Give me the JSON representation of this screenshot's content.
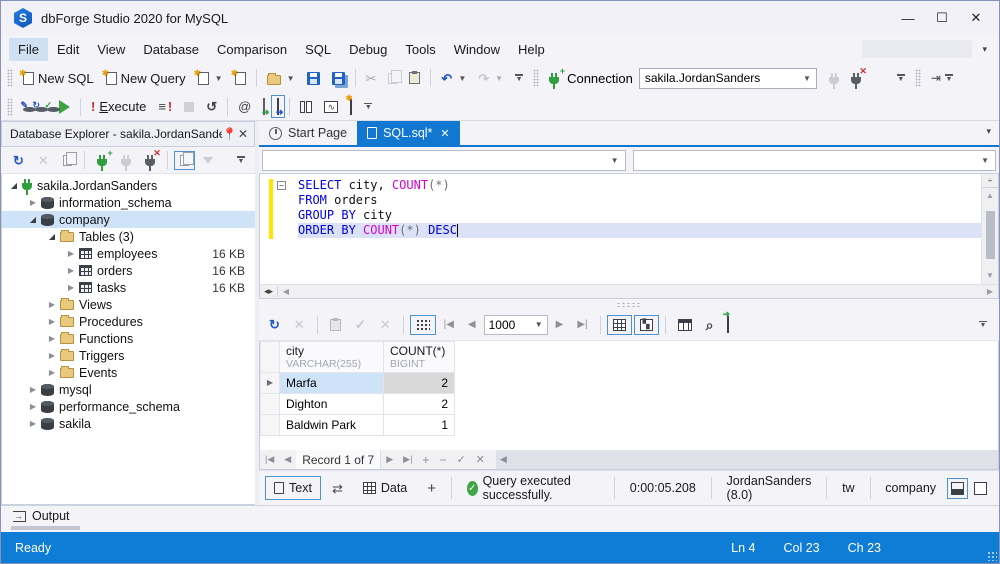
{
  "window": {
    "title": "dbForge Studio 2020 for MySQL",
    "minimize": "—",
    "maximize": "☐",
    "close": "✕"
  },
  "menu": {
    "items": [
      "File",
      "Edit",
      "View",
      "Database",
      "Comparison",
      "SQL",
      "Debug",
      "Tools",
      "Window",
      "Help"
    ]
  },
  "toolbar": {
    "new_sql": "New SQL",
    "new_query": "New Query",
    "execute": "Execute",
    "connection_label": "Connection",
    "connection_value": "sakila.JordanSanders"
  },
  "icons": {
    "cut": "✂",
    "undo": "↶",
    "redo": "↷",
    "refresh": "↻",
    "history": "↺",
    "close": "✕",
    "check": "✓",
    "exclaim": "!",
    "at": "@",
    "swap": "⇄",
    "plus": "+",
    "minus": "−",
    "search": "⌕",
    "cards": "▚",
    "prev": "◀",
    "next": "▶",
    "first": "|◀",
    "last": "▶|",
    "collapse": "−",
    "chart_line": "∿",
    "vsplit": "÷",
    "hsplit": "◂▸",
    "arrow_right": "→",
    "dropdown": "▼",
    "expander_closed": "▶",
    "expander_open": "◢",
    "row_arrow": "▶"
  },
  "explorer": {
    "title": "Database Explorer - sakila.JordanSanders",
    "tree": [
      {
        "label": "sakila.JordanSanders",
        "icon": "plug",
        "exp": "open",
        "level": 0
      },
      {
        "label": "information_schema",
        "icon": "db",
        "exp": "closed",
        "level": 1
      },
      {
        "label": "company",
        "icon": "db",
        "exp": "open",
        "level": 1,
        "selected": true
      },
      {
        "label": "Tables (3)",
        "icon": "folder",
        "exp": "open",
        "level": 2
      },
      {
        "label": "employees",
        "size": "16 KB",
        "icon": "table",
        "exp": "closed",
        "level": 3
      },
      {
        "label": "orders",
        "size": "16 KB",
        "icon": "table",
        "exp": "closed",
        "level": 3
      },
      {
        "label": "tasks",
        "size": "16 KB",
        "icon": "table",
        "exp": "closed",
        "level": 3
      },
      {
        "label": "Views",
        "icon": "folder",
        "exp": "closed",
        "level": 2
      },
      {
        "label": "Procedures",
        "icon": "folder",
        "exp": "closed",
        "level": 2
      },
      {
        "label": "Functions",
        "icon": "folder",
        "exp": "closed",
        "level": 2
      },
      {
        "label": "Triggers",
        "icon": "folder",
        "exp": "closed",
        "level": 2
      },
      {
        "label": "Events",
        "icon": "folder",
        "exp": "closed",
        "level": 2
      },
      {
        "label": "mysql",
        "icon": "db",
        "exp": "closed",
        "level": 1
      },
      {
        "label": "performance_schema",
        "icon": "db",
        "exp": "closed",
        "level": 1
      },
      {
        "label": "sakila",
        "icon": "db",
        "exp": "closed",
        "level": 1
      }
    ]
  },
  "tabs": [
    {
      "label": "Start Page",
      "active": false
    },
    {
      "label": "SQL.sql*",
      "active": true
    }
  ],
  "editor": {
    "lines": [
      {
        "tokens": [
          {
            "t": "SELECT",
            "c": "kw"
          },
          {
            "t": " city",
            "c": "id"
          },
          {
            "t": ", ",
            "c": "id"
          },
          {
            "t": "COUNT",
            "c": "fn"
          },
          {
            "t": "(*)",
            "c": "pn"
          }
        ]
      },
      {
        "tokens": [
          {
            "t": "FROM",
            "c": "kw"
          },
          {
            "t": " orders",
            "c": "id"
          }
        ]
      },
      {
        "tokens": [
          {
            "t": "GROUP BY",
            "c": "kw"
          },
          {
            "t": " city",
            "c": "id"
          }
        ]
      },
      {
        "tokens": [
          {
            "t": "ORDER BY",
            "c": "kw"
          },
          {
            "t": " ",
            "c": "id"
          },
          {
            "t": "COUNT",
            "c": "fn"
          },
          {
            "t": "(*)",
            "c": "pn"
          },
          {
            "t": " ",
            "c": "id"
          },
          {
            "t": "DESC",
            "c": "kw"
          }
        ],
        "highlighted": true,
        "caret": true
      }
    ]
  },
  "data_toolbar": {
    "page_size": "1000"
  },
  "grid": {
    "columns": [
      {
        "name": "city",
        "type": "VARCHAR(255)"
      },
      {
        "name": "COUNT(*)",
        "type": "BIGINT"
      }
    ],
    "rows": [
      {
        "city": "Marfa",
        "count": "2",
        "selected": true
      },
      {
        "city": "Dighton",
        "count": "2",
        "selected": false
      },
      {
        "city": "Baldwin Park",
        "count": "1",
        "selected": false
      }
    ]
  },
  "navigator": {
    "record_label": "Record 1 of 7"
  },
  "docbar": {
    "text_tab": "Text",
    "data_tab": "Data",
    "status": "Query executed successfully.",
    "duration": "0:00:05.208",
    "connection": "JordanSanders (8.0)",
    "server": "tw",
    "database": "company"
  },
  "output": {
    "label": "Output"
  },
  "statusbar": {
    "state": "Ready",
    "line": "Ln 4",
    "column": "Col 23",
    "char": "Ch 23"
  },
  "colors": {
    "accent_blue": "#1177d1",
    "statusbar_blue": "#0f7cd5",
    "highlight_yellow": "#ffe500",
    "success_green": "#3fa546"
  }
}
